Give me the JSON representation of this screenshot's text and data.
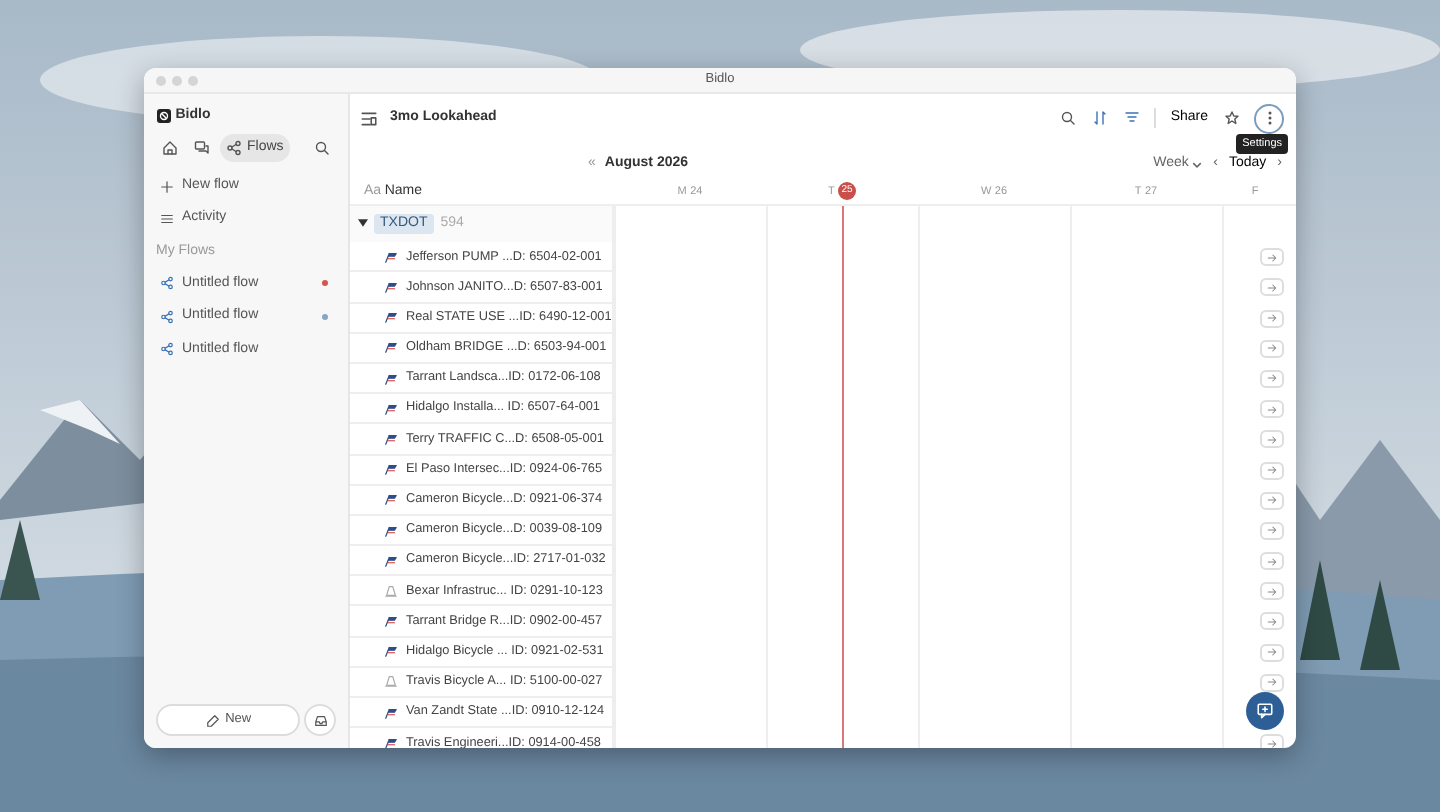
{
  "window": {
    "title": "Bidlo"
  },
  "sidebar": {
    "workspace": "Bidlo",
    "nav": [
      {
        "kind": "home",
        "selected": false
      },
      {
        "kind": "chat",
        "selected": false
      },
      {
        "kind": "flows",
        "label": "Flows",
        "selected": true
      },
      {
        "kind": "search",
        "selected": false
      }
    ],
    "actions": [
      {
        "kind": "plus",
        "label": "New flow"
      },
      {
        "kind": "list",
        "label": "Activity"
      }
    ],
    "section": "My Flows",
    "flows": [
      {
        "label": "Untitled flow",
        "color": "#d9534f"
      },
      {
        "label": "Untitled flow",
        "color": "#8aa4c8"
      },
      {
        "label": "Untitled flow"
      }
    ],
    "new_button": "New"
  },
  "toolbar": {
    "title": "3mo Lookahead",
    "share": "Share",
    "tooltip": "Settings"
  },
  "calendar": {
    "collapse": "«",
    "month": "August 2026",
    "view": "Week",
    "prev": "‹",
    "today": "Today",
    "next": "›",
    "days": [
      {
        "weekday": "M",
        "date": "24",
        "today": false
      },
      {
        "weekday": "T",
        "date": "25",
        "today": true
      },
      {
        "weekday": "W",
        "date": "26",
        "today": false
      },
      {
        "weekday": "T",
        "date": "27",
        "today": false
      },
      {
        "weekday": "F",
        "today": false
      }
    ]
  },
  "table": {
    "column_prefix": "Aa",
    "column": "Name",
    "group": {
      "label": "TXDOT",
      "count": "594",
      "expanded": true
    },
    "rows": [
      {
        "kind": "flag",
        "name": "Jefferson PUMP ...D: 6504-02-001"
      },
      {
        "kind": "flag",
        "name": "Johnson JANITO...D: 6507-83-001"
      },
      {
        "kind": "flag",
        "name": "Real STATE USE ...ID: 6490-12-001"
      },
      {
        "kind": "flag",
        "name": "Oldham BRIDGE ...D: 6503-94-001"
      },
      {
        "kind": "flag",
        "name": "Tarrant Landsca...ID: 0172-06-108"
      },
      {
        "kind": "flag",
        "name": "Hidalgo Installa... ID: 6507-64-001"
      },
      {
        "kind": "flag",
        "name": "Terry TRAFFIC C...D: 6508-05-001"
      },
      {
        "kind": "flag",
        "name": "El Paso Intersec...ID: 0924-06-765"
      },
      {
        "kind": "flag",
        "name": "Cameron Bicycle...D: 0921-06-374"
      },
      {
        "kind": "flag",
        "name": "Cameron Bicycle...D: 0039-08-109"
      },
      {
        "kind": "flag",
        "name": "Cameron Bicycle...ID: 2717-01-032"
      },
      {
        "kind": "cone",
        "name": "Bexar Infrastruc... ID: 0291-10-123"
      },
      {
        "kind": "flag",
        "name": "Tarrant Bridge R...ID: 0902-00-457"
      },
      {
        "kind": "flag",
        "name": "Hidalgo Bicycle ... ID: 0921-02-531"
      },
      {
        "kind": "cone",
        "name": "Travis Bicycle A... ID: 5100-00-027"
      },
      {
        "kind": "flag",
        "name": "Van Zandt State ...ID: 0910-12-124",
        "open_button": false
      },
      {
        "kind": "flag",
        "name": "Travis Engineeri...ID: 0914-00-458"
      }
    ]
  }
}
